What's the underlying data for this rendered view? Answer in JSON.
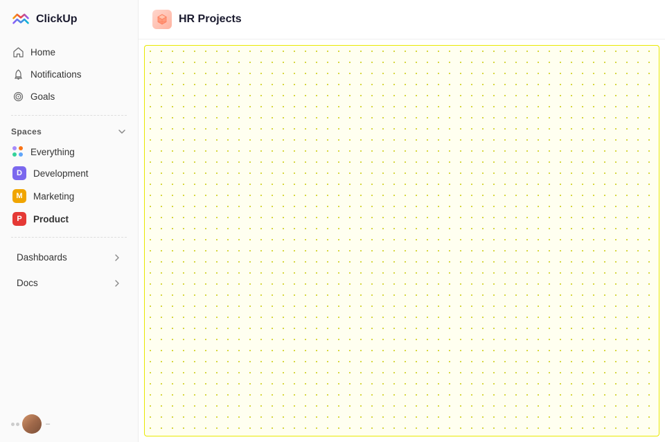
{
  "app": {
    "name": "ClickUp"
  },
  "sidebar": {
    "nav_items": [
      {
        "id": "home",
        "label": "Home",
        "icon": "home-icon"
      },
      {
        "id": "notifications",
        "label": "Notifications",
        "icon": "bell-icon"
      },
      {
        "id": "goals",
        "label": "Goals",
        "icon": "target-icon"
      }
    ],
    "spaces": {
      "label": "Spaces",
      "items": [
        {
          "id": "everything",
          "label": "Everything",
          "icon": "grid-icon",
          "color": null
        },
        {
          "id": "development",
          "label": "Development",
          "badge": "D",
          "color": "#7b68ee"
        },
        {
          "id": "marketing",
          "label": "Marketing",
          "badge": "M",
          "color": "#f0a500"
        },
        {
          "id": "product",
          "label": "Product",
          "badge": "P",
          "color": "#e53935",
          "active": true
        }
      ]
    },
    "sections": [
      {
        "id": "dashboards",
        "label": "Dashboards"
      },
      {
        "id": "docs",
        "label": "Docs"
      }
    ]
  },
  "main": {
    "title": "HR Projects",
    "icon": "📦"
  }
}
